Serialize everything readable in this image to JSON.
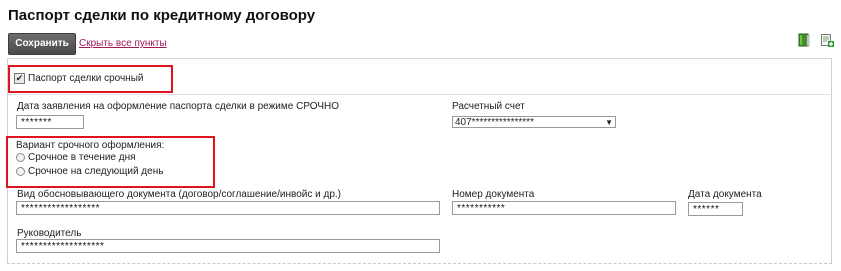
{
  "page": {
    "title": "Паспорт сделки по кредитному договору"
  },
  "toolbar": {
    "save_label": "Сохранить",
    "collapse_link": "Скрыть все пункты",
    "icons": [
      "book-icon",
      "add-document-icon"
    ]
  },
  "urgent": {
    "checkbox_label": "Паспорт сделки срочный",
    "checked": true
  },
  "form": {
    "application_date_label": "Дата заявления на оформление паспорта сделки в режиме СРОЧНО",
    "application_date_value": "*******",
    "account_label": "Расчетный счет",
    "account_value": "407****************",
    "urgency_label": "Вариант срочного оформления:",
    "urgency_options": [
      "Срочное в течение дня",
      "Срочное на следующий день"
    ],
    "doc_type_label": "Вид обосновывающего документа (договор/соглашение/инвойс и др.)",
    "doc_type_value": "******************",
    "doc_number_label": "Номер документа",
    "doc_number_value": "***********",
    "doc_date_label": "Дата документа",
    "doc_date_value": "******",
    "manager_label": "Руководитель",
    "manager_value": "*******************"
  },
  "colors": {
    "highlight": "#e0141e",
    "link": "#a01a5a",
    "button": "#555555"
  }
}
